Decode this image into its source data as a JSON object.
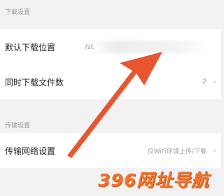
{
  "download_section": {
    "header": "下载设置",
    "rows": [
      {
        "label": "默认下载位置",
        "value": "/st"
      },
      {
        "label": "同时下载文件数",
        "value": "2"
      }
    ]
  },
  "transfer_section": {
    "header": "传输设置",
    "rows": [
      {
        "label": "传输网络设置",
        "value": "仅WiFi环境上传/下载"
      }
    ]
  },
  "icons": {
    "chevron": "chevron-right-icon",
    "annotation_arrow": "red-arrow-icon"
  },
  "watermark": "396网址导航",
  "colors": {
    "background": "#f2f2f4",
    "arrow": "#e8552f",
    "watermark": "#f06b1c"
  }
}
